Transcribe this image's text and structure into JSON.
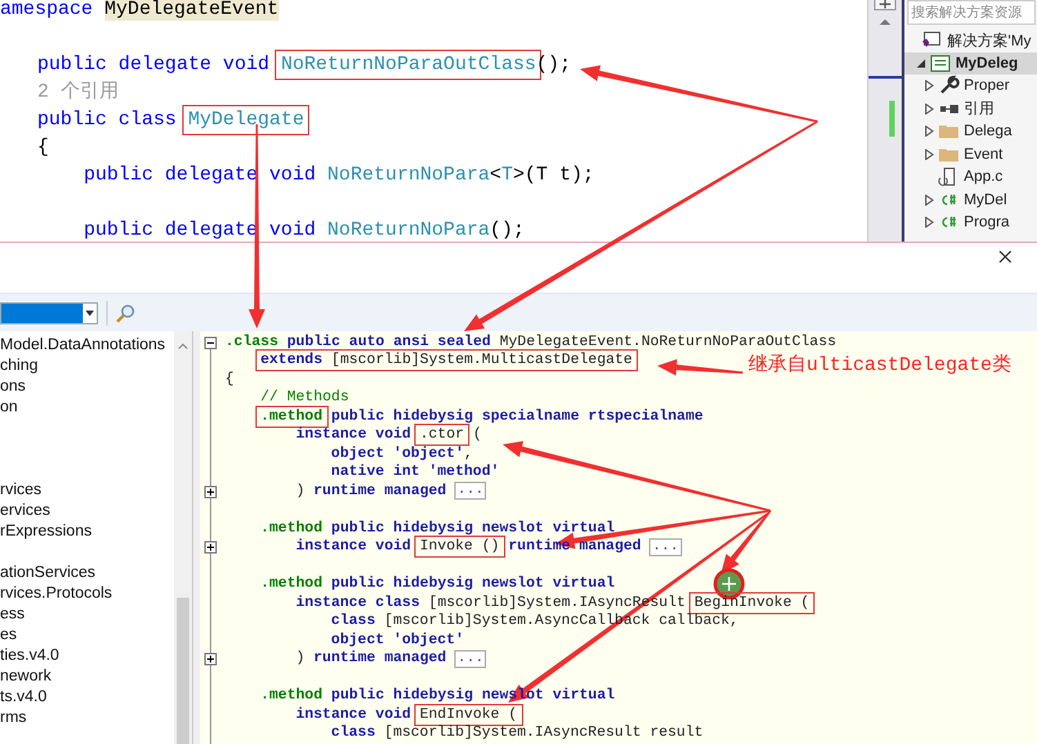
{
  "editor": {
    "lines": [
      {
        "kind": "code",
        "tokens": [
          {
            "text": "amespace ",
            "kind": "kw",
            "boxed": false
          },
          {
            "text": "MyDelegateEvent",
            "kind": "highlight",
            "boxed": false
          }
        ],
        "children": [
          {
            "kind": "blank"
          },
          {
            "kind": "code",
            "tokens": [
              {
                "text": "public delegate void ",
                "kind": "kw",
                "boxed": false
              },
              {
                "text": "NoReturnNoParaOutClass",
                "kind": "type",
                "boxed": true
              },
              {
                "text": "();",
                "kind": "plain",
                "boxed": false
              }
            ]
          },
          {
            "kind": "lens",
            "tokens": [
              {
                "text": "2 个引用",
                "kind": "lens",
                "boxed": false
              }
            ]
          },
          {
            "kind": "code",
            "tokens": [
              {
                "text": "public class ",
                "kind": "kw",
                "boxed": false
              },
              {
                "text": "MyDelegate",
                "kind": "type",
                "boxed": true
              }
            ]
          },
          {
            "kind": "code",
            "tokens": [
              {
                "text": "{",
                "kind": "plain",
                "boxed": false
              }
            ],
            "children": [
              {
                "kind": "code",
                "tokens": [
                  {
                    "text": "public delegate void ",
                    "kind": "kw",
                    "boxed": false
                  },
                  {
                    "text": "NoReturnNoPara",
                    "kind": "type",
                    "boxed": false
                  },
                  {
                    "text": "<",
                    "kind": "plain",
                    "boxed": false
                  },
                  {
                    "text": "T",
                    "kind": "type",
                    "boxed": false
                  },
                  {
                    "text": ">(T t);",
                    "kind": "plain",
                    "boxed": false
                  }
                ]
              },
              {
                "kind": "blank"
              },
              {
                "kind": "code",
                "tokens": [
                  {
                    "text": "public delegate void ",
                    "kind": "kw",
                    "boxed": false
                  },
                  {
                    "text": "NoReturnNoPara",
                    "kind": "type",
                    "boxed": false
                  },
                  {
                    "text": "();",
                    "kind": "plain",
                    "boxed": false
                  }
                ]
              }
            ]
          }
        ]
      }
    ]
  },
  "solution_explorer": {
    "search": {
      "placeholder": "搜索解决方案资源"
    },
    "items": [
      {
        "label": "解决方案'My",
        "kind": "solution",
        "selected": false,
        "children": [
          {
            "label": "MyDeleg",
            "kind": "project",
            "selected": true,
            "expanded": true,
            "children": [
              {
                "label": "Proper",
                "kind": "properties",
                "selected": false,
                "expanded": false
              },
              {
                "label": "引用",
                "kind": "references",
                "selected": false,
                "expanded": false
              },
              {
                "label": "Delega",
                "kind": "folder",
                "selected": false,
                "expanded": false
              },
              {
                "label": "Event",
                "kind": "folder",
                "selected": false,
                "expanded": false
              },
              {
                "label": "App.c",
                "kind": "config",
                "selected": false
              },
              {
                "label": "MyDel",
                "kind": "csfile",
                "selected": false,
                "expanded": false
              },
              {
                "label": "Progra",
                "kind": "csfile",
                "selected": false,
                "expanded": false
              }
            ]
          }
        ]
      }
    ]
  },
  "decompiler": {
    "tree_items": [
      {
        "kind": "name",
        "label": "Model.DataAnnotations"
      },
      {
        "kind": "name",
        "label": "ching"
      },
      {
        "kind": "name",
        "label": "ons"
      },
      {
        "kind": "name",
        "label": "on"
      },
      {
        "kind": "clipped"
      },
      {
        "kind": "clipped"
      },
      {
        "kind": "clipped"
      },
      {
        "kind": "name",
        "label": "rvices"
      },
      {
        "kind": "name",
        "label": "ervices"
      },
      {
        "kind": "name",
        "label": "rExpressions"
      },
      {
        "kind": "clipped"
      },
      {
        "kind": "name",
        "label": "ationServices"
      },
      {
        "kind": "name",
        "label": "rvices.Protocols"
      },
      {
        "kind": "name",
        "label": "ess"
      },
      {
        "kind": "name",
        "label": "es"
      },
      {
        "kind": "name",
        "label": "ties.v4.0"
      },
      {
        "kind": "name",
        "label": "nework"
      },
      {
        "kind": "name",
        "label": "ts.v4.0"
      },
      {
        "kind": "name",
        "label": "rms"
      }
    ],
    "il_lines": [
      {
        "kind": "code",
        "expanded": true,
        "tokens": [
          {
            "text": ".class",
            "kind": "dir",
            "boxed": false
          },
          {
            "text": " public auto ansi sealed ",
            "kind": "kw",
            "boxed": false
          },
          {
            "text": "MyDelegateEvent.NoReturnNoParaOutClass",
            "kind": "plain",
            "boxed": false
          }
        ],
        "children": [
          {
            "kind": "code",
            "tokens": [
              {
                "text": "extends ",
                "kind": "kw",
                "boxed": true
              },
              {
                "text": "[mscorlib]System.MulticastDelegate",
                "kind": "plain",
                "boxed": true
              }
            ]
          }
        ]
      },
      {
        "kind": "code",
        "tokens": [
          {
            "text": "{",
            "kind": "plain",
            "boxed": false
          }
        ],
        "children": [
          {
            "kind": "code",
            "tokens": [
              {
                "text": "// Methods",
                "kind": "comment",
                "boxed": false
              }
            ]
          },
          {
            "kind": "code",
            "tokens": [
              {
                "text": ".method",
                "kind": "dir",
                "boxed": true
              },
              {
                "text": " public hidebysig specialname rtspecialname",
                "kind": "kw",
                "boxed": false
              }
            ],
            "children": [
              {
                "kind": "code",
                "tokens": [
                  {
                    "text": "instance void ",
                    "kind": "kw",
                    "boxed": false
                  },
                  {
                    "text": ".ctor",
                    "kind": "plain",
                    "boxed": true
                  },
                  {
                    "text": " (",
                    "kind": "plain",
                    "boxed": false
                  }
                ],
                "children": [
                  {
                    "kind": "code",
                    "tokens": [
                      {
                        "text": "object 'object'",
                        "kind": "kw",
                        "boxed": false
                      },
                      {
                        "text": ",",
                        "kind": "plain",
                        "boxed": false
                      }
                    ]
                  },
                  {
                    "kind": "code",
                    "tokens": [
                      {
                        "text": "native int 'method'",
                        "kind": "kw",
                        "boxed": false
                      }
                    ]
                  }
                ]
              },
              {
                "kind": "code",
                "expanded": false,
                "tokens": [
                  {
                    "text": ") ",
                    "kind": "plain",
                    "boxed": false
                  },
                  {
                    "text": "runtime managed",
                    "kind": "kw",
                    "boxed": false
                  },
                  {
                    "text": "...",
                    "kind": "more",
                    "boxed": false
                  }
                ]
              }
            ]
          },
          {
            "kind": "blank"
          },
          {
            "kind": "code",
            "tokens": [
              {
                "text": ".method",
                "kind": "dir",
                "boxed": false
              },
              {
                "text": " public hidebysig newslot virtual",
                "kind": "kw",
                "boxed": false
              }
            ],
            "children": [
              {
                "kind": "code",
                "expanded": false,
                "tokens": [
                  {
                    "text": "instance void ",
                    "kind": "kw",
                    "boxed": false
                  },
                  {
                    "text": "Invoke ()",
                    "kind": "plain",
                    "boxed": true
                  },
                  {
                    "text": " runtime managed",
                    "kind": "kw",
                    "boxed": false
                  },
                  {
                    "text": "...",
                    "kind": "more",
                    "boxed": false
                  }
                ]
              }
            ]
          },
          {
            "kind": "blank"
          },
          {
            "kind": "code",
            "tokens": [
              {
                "text": ".method",
                "kind": "dir",
                "boxed": false
              },
              {
                "text": " public hidebysig newslot virtual",
                "kind": "kw",
                "boxed": false
              }
            ],
            "children": [
              {
                "kind": "code",
                "tokens": [
                  {
                    "text": "instance class ",
                    "kind": "kw",
                    "boxed": false
                  },
                  {
                    "text": "[mscorlib]System.IAsyncResult ",
                    "kind": "plain",
                    "boxed": false
                  },
                  {
                    "text": "BeginInvoke (",
                    "kind": "plain",
                    "boxed": true
                  }
                ],
                "children": [
                  {
                    "kind": "code",
                    "tokens": [
                      {
                        "text": "class ",
                        "kind": "kw",
                        "boxed": false
                      },
                      {
                        "text": "[mscorlib]System.AsyncCallback callback,",
                        "kind": "plain",
                        "boxed": false
                      }
                    ]
                  },
                  {
                    "kind": "code",
                    "tokens": [
                      {
                        "text": "object 'object'",
                        "kind": "kw",
                        "boxed": false
                      }
                    ]
                  }
                ]
              },
              {
                "kind": "code",
                "expanded": false,
                "tokens": [
                  {
                    "text": ") ",
                    "kind": "plain",
                    "boxed": false
                  },
                  {
                    "text": "runtime managed",
                    "kind": "kw",
                    "boxed": false
                  },
                  {
                    "text": "...",
                    "kind": "more",
                    "boxed": false
                  }
                ]
              }
            ]
          },
          {
            "kind": "blank"
          },
          {
            "kind": "code",
            "tokens": [
              {
                "text": ".method",
                "kind": "dir",
                "boxed": false
              },
              {
                "text": " public hidebysig newslot virtual",
                "kind": "kw",
                "boxed": false
              }
            ],
            "children": [
              {
                "kind": "code",
                "tokens": [
                  {
                    "text": "instance void ",
                    "kind": "kw",
                    "boxed": false
                  },
                  {
                    "text": "EndInvoke (",
                    "kind": "plain",
                    "boxed": true
                  }
                ],
                "children": [
                  {
                    "kind": "code",
                    "tokens": [
                      {
                        "text": "class ",
                        "kind": "kw",
                        "boxed": false
                      },
                      {
                        "text": "[mscorlib]System.IAsyncResult result",
                        "kind": "plain",
                        "boxed": false
                      }
                    ]
                  }
                ]
              }
            ]
          }
        ]
      }
    ]
  },
  "annotation": {
    "note": "继承自ulticastDelegate类"
  }
}
